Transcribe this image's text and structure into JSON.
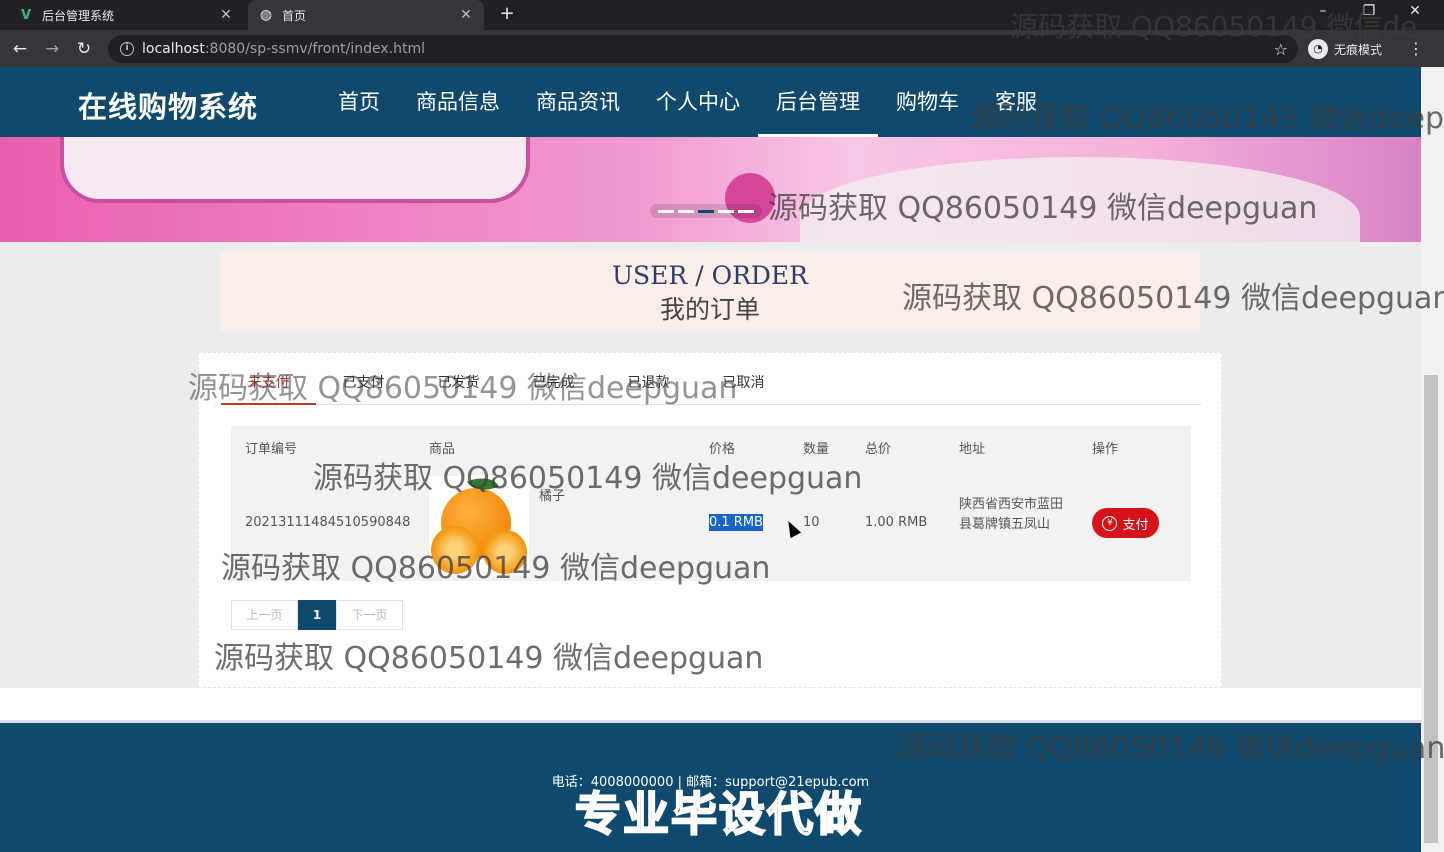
{
  "browser": {
    "tabs": [
      {
        "title": "后台管理系统",
        "favicon": "vue-icon",
        "active": false
      },
      {
        "title": "首页",
        "favicon": "globe-icon",
        "active": true
      }
    ],
    "url_host": "localhost",
    "url_path": ":8080/sp-ssmv/front/index.html",
    "incognito_label": "无痕模式"
  },
  "site": {
    "brand": "在线购物系统",
    "menu": [
      "首页",
      "商品信息",
      "商品资讯",
      "个人中心",
      "后台管理",
      "购物车",
      "客服"
    ],
    "active_menu": "后台管理",
    "banner_dots": 5,
    "banner_active_dot": 3
  },
  "order_header": {
    "en": "USER / ORDER",
    "cn": "我的订单"
  },
  "order_tabs": [
    "未支付",
    "已支付",
    "已发货",
    "已完成",
    "已退款",
    "已取消"
  ],
  "order_tab_active": "未支付",
  "table": {
    "headers": [
      "订单编号",
      "商品",
      "价格",
      "数量",
      "总价",
      "地址",
      "操作"
    ],
    "rows": [
      {
        "order_no": "20213111484510590848",
        "product": "橘子",
        "price": "0.1 RMB",
        "qty": "10",
        "total": "1.00 RMB",
        "address": "陕西省西安市蓝田县葛牌镇五凤山",
        "action": "支付"
      }
    ]
  },
  "pager": {
    "prev": "上一页",
    "current": "1",
    "next": "下一页"
  },
  "footer": {
    "contact": "电话：4008000000 | 邮箱：support@21epub.com"
  },
  "watermark": {
    "text": "源码获取 QQ86050149 微信deepguan",
    "text_clipped": "源码获取 QQ86050149 微信de",
    "banner": "专业毕设代做"
  },
  "colors": {
    "nav": "#0f4a6e",
    "pay": "#d4141a",
    "active_tab": "#c0392b"
  }
}
